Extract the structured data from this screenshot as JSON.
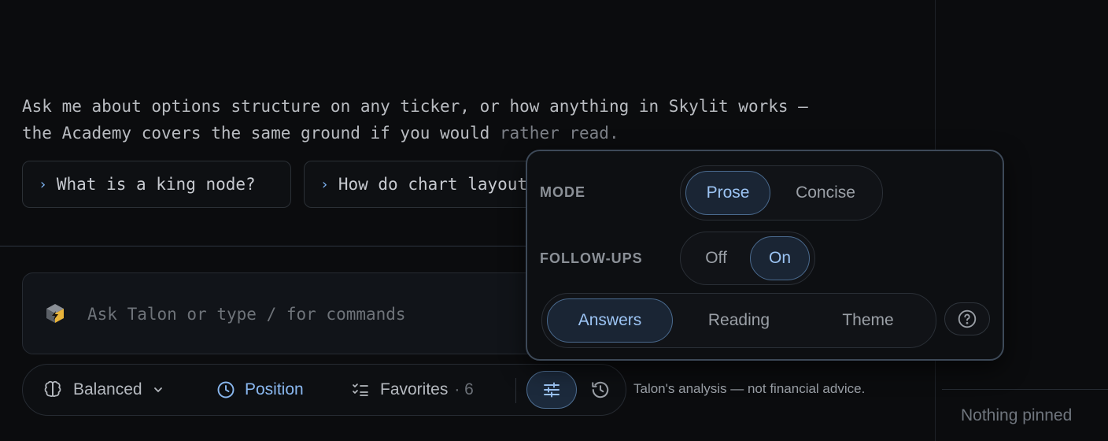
{
  "conversation": {
    "intro_line1": "Ask me about options structure on any ticker, or how anything in Skylit works —",
    "intro_line2": "the Academy covers the same ground if you would ",
    "intro_line2_faded": "rather read.",
    "suggestions": [
      {
        "label": "What is a king node?"
      },
      {
        "label": "How do chart layouts work?"
      }
    ]
  },
  "composer": {
    "placeholder": "Ask Talon or type / for commands",
    "value": ""
  },
  "toolbar": {
    "model": "Balanced",
    "position": "Position",
    "favorites": "Favorites",
    "favorites_count": "· 6"
  },
  "disclaimer": "Talon's analysis — not financial advice.",
  "pinned": {
    "empty_text": "Nothing pinned"
  },
  "settings_popover": {
    "mode": {
      "label": "MODE",
      "options": [
        "Prose",
        "Concise"
      ],
      "selected": "Prose"
    },
    "followups": {
      "label": "FOLLOW-UPS",
      "options": [
        "Off",
        "On"
      ],
      "selected": "On"
    },
    "tabs": {
      "options": [
        "Answers",
        "Reading",
        "Theme"
      ],
      "selected": "Answers"
    }
  },
  "colors": {
    "background": "#0b0c0e",
    "accent": "#8ab8f0",
    "selected_fill": "#1a2534",
    "selected_border": "#4a6a8e",
    "cube_gold": "#e8b33a"
  },
  "icons": {
    "composer": "talon-cube-icon",
    "model": "brain-icon",
    "model_dropdown": "chevron-down-icon",
    "position": "clock-icon",
    "favorites": "list-check-icon",
    "settings": "sliders-icon",
    "history": "history-icon",
    "help": "question-circle-icon",
    "suggestion": "chevron-right-icon"
  }
}
